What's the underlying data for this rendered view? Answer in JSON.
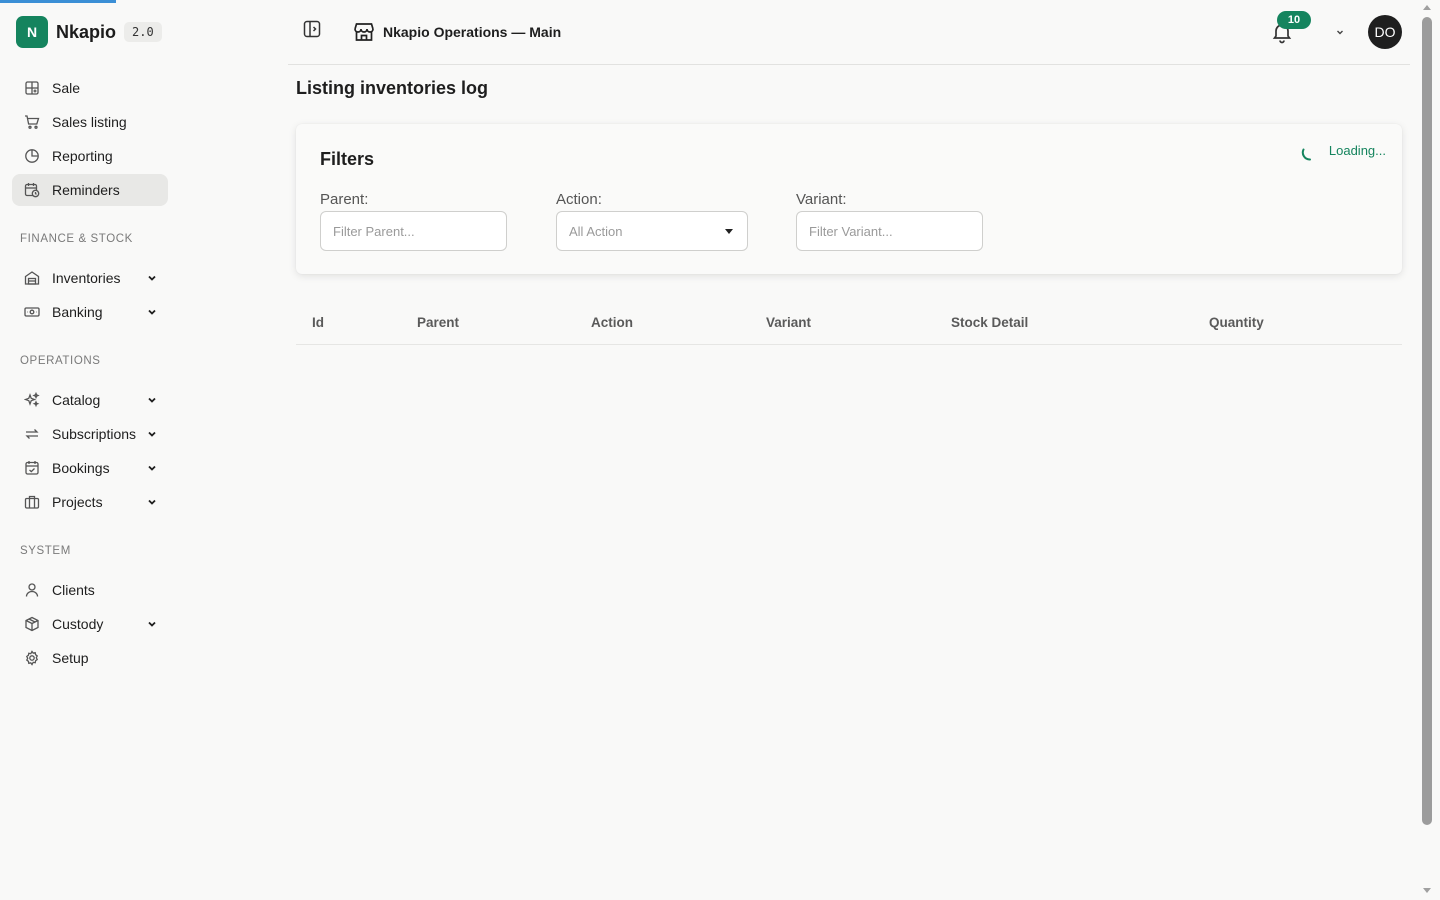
{
  "brand": {
    "logo_letter": "N",
    "name": "Nkapio",
    "version": "2.0",
    "accent": "#15845e"
  },
  "sidebar": {
    "top_items": [
      {
        "label": "Sale",
        "icon": "grid-plus-icon"
      },
      {
        "label": "Sales listing",
        "icon": "cart-icon"
      },
      {
        "label": "Reporting",
        "icon": "pie-chart-icon"
      },
      {
        "label": "Reminders",
        "icon": "calendar-clock-icon",
        "active": true
      }
    ],
    "sections": [
      {
        "title": "FINANCE & STOCK",
        "items": [
          {
            "label": "Inventories",
            "icon": "warehouse-icon",
            "expandable": true
          },
          {
            "label": "Banking",
            "icon": "banknote-icon",
            "expandable": true
          }
        ]
      },
      {
        "title": "OPERATIONS",
        "items": [
          {
            "label": "Catalog",
            "icon": "sparkles-icon",
            "expandable": true
          },
          {
            "label": "Subscriptions",
            "icon": "repeat-icon",
            "expandable": true
          },
          {
            "label": "Bookings",
            "icon": "calendar-check-icon",
            "expandable": true
          },
          {
            "label": "Projects",
            "icon": "briefcase-icon",
            "expandable": true
          }
        ]
      },
      {
        "title": "SYSTEM",
        "items": [
          {
            "label": "Clients",
            "icon": "user-icon",
            "expandable": false
          },
          {
            "label": "Custody",
            "icon": "package-icon",
            "expandable": true
          },
          {
            "label": "Setup",
            "icon": "gear-icon",
            "expandable": false
          }
        ]
      }
    ]
  },
  "header": {
    "store_name": "Nkapio Operations — Main",
    "notifications_count": "10",
    "avatar_initials": "DO"
  },
  "page": {
    "title": "Listing inventories log",
    "filters": {
      "title": "Filters",
      "loading_text": "Loading...",
      "parent_label": "Parent:",
      "parent_placeholder": "Filter Parent...",
      "action_label": "Action:",
      "action_value": "All Action",
      "variant_label": "Variant:",
      "variant_placeholder": "Filter Variant..."
    },
    "table": {
      "columns": [
        "Id",
        "Parent",
        "Action",
        "Variant",
        "Stock Detail",
        "Quantity"
      ],
      "rows": []
    }
  }
}
